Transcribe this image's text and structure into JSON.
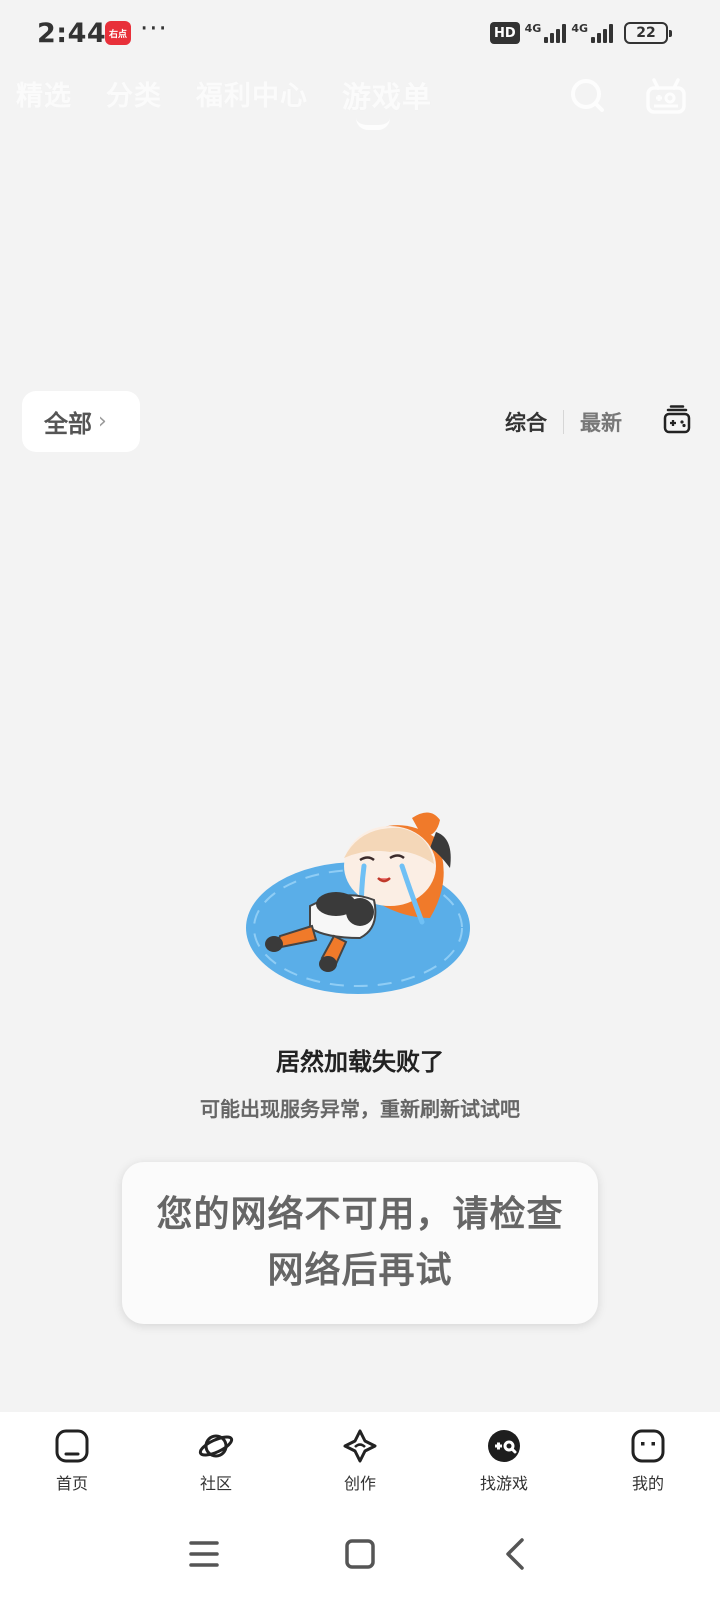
{
  "status_bar": {
    "time": "2:44",
    "app_badge": "右点",
    "more": "···",
    "hd": "HD",
    "net1": "4G",
    "net2": "4G",
    "battery": "22"
  },
  "top_tabs": [
    {
      "label": "精选",
      "active": false
    },
    {
      "label": "分类",
      "active": false
    },
    {
      "label": "福利中心",
      "active": false
    },
    {
      "label": "游戏单",
      "active": true
    }
  ],
  "top_icons": {
    "search": "search-icon",
    "game": "gamepad-robot-icon"
  },
  "filter": {
    "all_label": "全部",
    "chevron": "›",
    "sort": [
      {
        "label": "综合",
        "active": true
      },
      {
        "label": "最新",
        "active": false
      }
    ],
    "filter_icon": "game-list-icon"
  },
  "empty_state": {
    "title": "居然加载失败了",
    "subtitle": "可能出现服务异常，重新刷新试试吧"
  },
  "toast": {
    "message": "您的网络不可用，请检查网络后再试"
  },
  "bottom_nav": [
    {
      "label": "首页",
      "icon": "home-icon"
    },
    {
      "label": "社区",
      "icon": "planet-icon"
    },
    {
      "label": "创作",
      "icon": "create-icon"
    },
    {
      "label": "找游戏",
      "icon": "find-game-icon"
    },
    {
      "label": "我的",
      "icon": "profile-icon"
    }
  ],
  "colors": {
    "background": "#f3f3f3",
    "accent_start": "#ff5a1f",
    "accent_end": "#ff9a1f",
    "puddle": "#5aaee8"
  }
}
